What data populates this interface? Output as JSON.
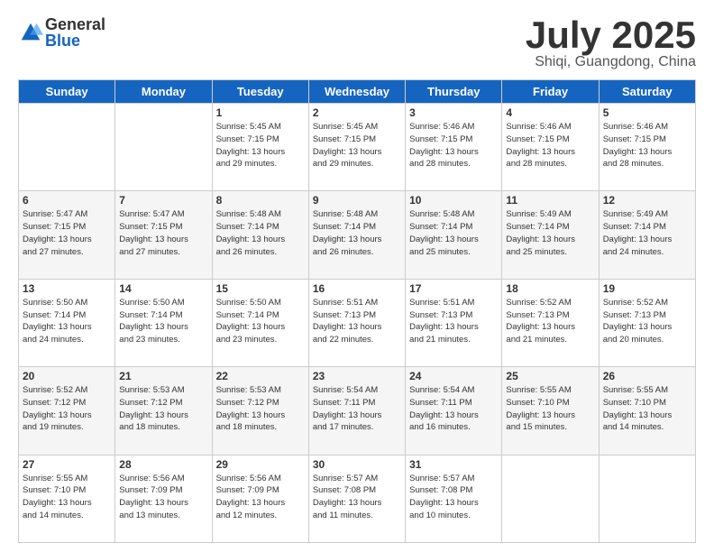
{
  "header": {
    "logo_general": "General",
    "logo_blue": "Blue",
    "month_title": "July 2025",
    "location": "Shiqi, Guangdong, China"
  },
  "days_of_week": [
    "Sunday",
    "Monday",
    "Tuesday",
    "Wednesday",
    "Thursday",
    "Friday",
    "Saturday"
  ],
  "weeks": [
    [
      {
        "day": "",
        "info": ""
      },
      {
        "day": "",
        "info": ""
      },
      {
        "day": "1",
        "info": "Sunrise: 5:45 AM\nSunset: 7:15 PM\nDaylight: 13 hours\nand 29 minutes."
      },
      {
        "day": "2",
        "info": "Sunrise: 5:45 AM\nSunset: 7:15 PM\nDaylight: 13 hours\nand 29 minutes."
      },
      {
        "day": "3",
        "info": "Sunrise: 5:46 AM\nSunset: 7:15 PM\nDaylight: 13 hours\nand 28 minutes."
      },
      {
        "day": "4",
        "info": "Sunrise: 5:46 AM\nSunset: 7:15 PM\nDaylight: 13 hours\nand 28 minutes."
      },
      {
        "day": "5",
        "info": "Sunrise: 5:46 AM\nSunset: 7:15 PM\nDaylight: 13 hours\nand 28 minutes."
      }
    ],
    [
      {
        "day": "6",
        "info": "Sunrise: 5:47 AM\nSunset: 7:15 PM\nDaylight: 13 hours\nand 27 minutes."
      },
      {
        "day": "7",
        "info": "Sunrise: 5:47 AM\nSunset: 7:15 PM\nDaylight: 13 hours\nand 27 minutes."
      },
      {
        "day": "8",
        "info": "Sunrise: 5:48 AM\nSunset: 7:14 PM\nDaylight: 13 hours\nand 26 minutes."
      },
      {
        "day": "9",
        "info": "Sunrise: 5:48 AM\nSunset: 7:14 PM\nDaylight: 13 hours\nand 26 minutes."
      },
      {
        "day": "10",
        "info": "Sunrise: 5:48 AM\nSunset: 7:14 PM\nDaylight: 13 hours\nand 25 minutes."
      },
      {
        "day": "11",
        "info": "Sunrise: 5:49 AM\nSunset: 7:14 PM\nDaylight: 13 hours\nand 25 minutes."
      },
      {
        "day": "12",
        "info": "Sunrise: 5:49 AM\nSunset: 7:14 PM\nDaylight: 13 hours\nand 24 minutes."
      }
    ],
    [
      {
        "day": "13",
        "info": "Sunrise: 5:50 AM\nSunset: 7:14 PM\nDaylight: 13 hours\nand 24 minutes."
      },
      {
        "day": "14",
        "info": "Sunrise: 5:50 AM\nSunset: 7:14 PM\nDaylight: 13 hours\nand 23 minutes."
      },
      {
        "day": "15",
        "info": "Sunrise: 5:50 AM\nSunset: 7:14 PM\nDaylight: 13 hours\nand 23 minutes."
      },
      {
        "day": "16",
        "info": "Sunrise: 5:51 AM\nSunset: 7:13 PM\nDaylight: 13 hours\nand 22 minutes."
      },
      {
        "day": "17",
        "info": "Sunrise: 5:51 AM\nSunset: 7:13 PM\nDaylight: 13 hours\nand 21 minutes."
      },
      {
        "day": "18",
        "info": "Sunrise: 5:52 AM\nSunset: 7:13 PM\nDaylight: 13 hours\nand 21 minutes."
      },
      {
        "day": "19",
        "info": "Sunrise: 5:52 AM\nSunset: 7:13 PM\nDaylight: 13 hours\nand 20 minutes."
      }
    ],
    [
      {
        "day": "20",
        "info": "Sunrise: 5:52 AM\nSunset: 7:12 PM\nDaylight: 13 hours\nand 19 minutes."
      },
      {
        "day": "21",
        "info": "Sunrise: 5:53 AM\nSunset: 7:12 PM\nDaylight: 13 hours\nand 18 minutes."
      },
      {
        "day": "22",
        "info": "Sunrise: 5:53 AM\nSunset: 7:12 PM\nDaylight: 13 hours\nand 18 minutes."
      },
      {
        "day": "23",
        "info": "Sunrise: 5:54 AM\nSunset: 7:11 PM\nDaylight: 13 hours\nand 17 minutes."
      },
      {
        "day": "24",
        "info": "Sunrise: 5:54 AM\nSunset: 7:11 PM\nDaylight: 13 hours\nand 16 minutes."
      },
      {
        "day": "25",
        "info": "Sunrise: 5:55 AM\nSunset: 7:10 PM\nDaylight: 13 hours\nand 15 minutes."
      },
      {
        "day": "26",
        "info": "Sunrise: 5:55 AM\nSunset: 7:10 PM\nDaylight: 13 hours\nand 14 minutes."
      }
    ],
    [
      {
        "day": "27",
        "info": "Sunrise: 5:55 AM\nSunset: 7:10 PM\nDaylight: 13 hours\nand 14 minutes."
      },
      {
        "day": "28",
        "info": "Sunrise: 5:56 AM\nSunset: 7:09 PM\nDaylight: 13 hours\nand 13 minutes."
      },
      {
        "day": "29",
        "info": "Sunrise: 5:56 AM\nSunset: 7:09 PM\nDaylight: 13 hours\nand 12 minutes."
      },
      {
        "day": "30",
        "info": "Sunrise: 5:57 AM\nSunset: 7:08 PM\nDaylight: 13 hours\nand 11 minutes."
      },
      {
        "day": "31",
        "info": "Sunrise: 5:57 AM\nSunset: 7:08 PM\nDaylight: 13 hours\nand 10 minutes."
      },
      {
        "day": "",
        "info": ""
      },
      {
        "day": "",
        "info": ""
      }
    ]
  ]
}
